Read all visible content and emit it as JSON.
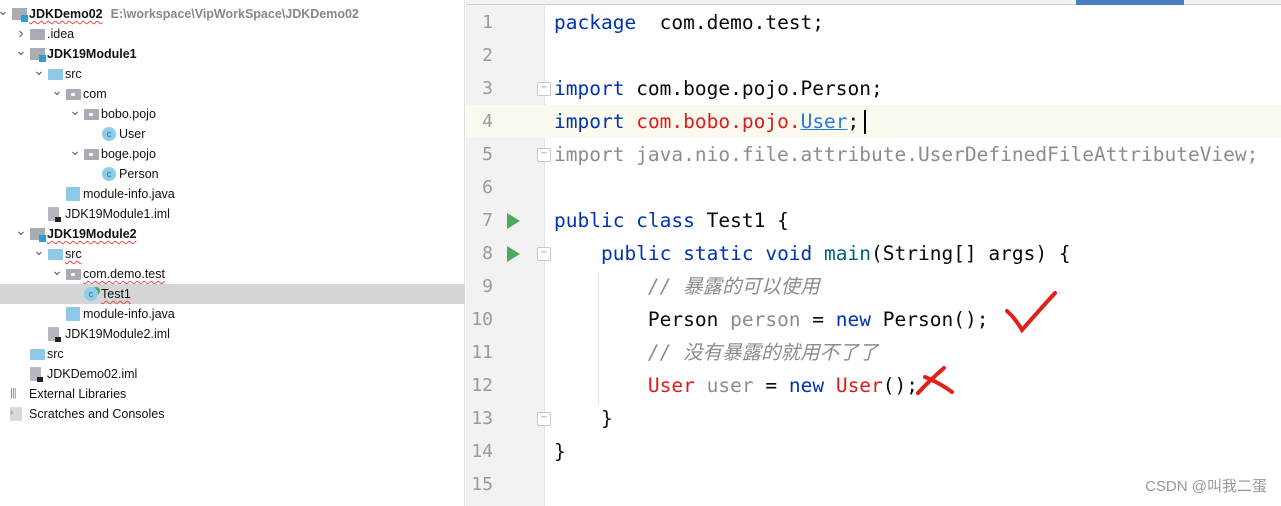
{
  "project_tree": {
    "items": [
      {
        "label": "JDKDemo02",
        "path": "E:\\workspace\\VipWorkSpace\\JDKDemo02",
        "level": 0,
        "icon": "module-icon",
        "expanded": true,
        "bold": true,
        "error": true
      },
      {
        "label": ".idea",
        "level": 1,
        "icon": "folder-icon",
        "expanded": false
      },
      {
        "label": "JDK19Module1",
        "level": 1,
        "icon": "module-icon",
        "expanded": true,
        "bold": true
      },
      {
        "label": "src",
        "level": 2,
        "icon": "source-folder-icon",
        "expanded": true
      },
      {
        "label": "com",
        "level": 3,
        "icon": "package-icon",
        "expanded": true
      },
      {
        "label": "bobo.pojo",
        "level": 4,
        "icon": "package-icon",
        "expanded": true
      },
      {
        "label": "User",
        "level": 5,
        "icon": "class-icon"
      },
      {
        "label": "boge.pojo",
        "level": 4,
        "icon": "package-icon",
        "expanded": true
      },
      {
        "label": "Person",
        "level": 5,
        "icon": "class-icon"
      },
      {
        "label": "module-info.java",
        "level": 3,
        "icon": "java-file-icon"
      },
      {
        "label": "JDK19Module1.iml",
        "level": 2,
        "icon": "iml-file-icon"
      },
      {
        "label": "JDK19Module2",
        "level": 1,
        "icon": "module-icon",
        "expanded": true,
        "bold": true,
        "error": true
      },
      {
        "label": "src",
        "level": 2,
        "icon": "source-folder-icon",
        "expanded": true,
        "error": true
      },
      {
        "label": "com.demo.test",
        "level": 3,
        "icon": "package-icon",
        "expanded": true,
        "error": true
      },
      {
        "label": "Test1",
        "level": 4,
        "icon": "runnable-class-icon",
        "selected": true,
        "error": true
      },
      {
        "label": "module-info.java",
        "level": 3,
        "icon": "java-file-icon"
      },
      {
        "label": "JDK19Module2.iml",
        "level": 2,
        "icon": "iml-file-icon"
      },
      {
        "label": "src",
        "level": 1,
        "icon": "source-folder-icon"
      },
      {
        "label": "JDKDemo02.iml",
        "level": 1,
        "icon": "iml-file-icon"
      },
      {
        "label": "External Libraries",
        "level": 0,
        "icon": "libraries-icon"
      },
      {
        "label": "Scratches and Consoles",
        "level": 0,
        "icon": "scratches-icon"
      }
    ]
  },
  "editor": {
    "current_line": 4,
    "lines": [
      {
        "n": "1",
        "tokens": [
          [
            "kw",
            "package"
          ],
          [
            "",
            "  com.demo.test;"
          ]
        ]
      },
      {
        "n": "2",
        "tokens": []
      },
      {
        "n": "3",
        "fold": true,
        "tokens": [
          [
            "kw",
            "import"
          ],
          [
            "",
            " com.boge.pojo.Person;"
          ]
        ]
      },
      {
        "n": "4",
        "tokens": [
          [
            "kw",
            "import"
          ],
          [
            "",
            " "
          ],
          [
            "red",
            "com.bobo.pojo."
          ],
          [
            "link",
            "User"
          ],
          [
            "",
            ";"
          ]
        ]
      },
      {
        "n": "5",
        "fold": true,
        "tokens": [
          [
            "gray",
            "import java.nio.file.attribute.UserDefinedFileAttributeView;"
          ]
        ]
      },
      {
        "n": "6",
        "tokens": []
      },
      {
        "n": "7",
        "run": true,
        "tokens": [
          [
            "kw",
            "public class"
          ],
          [
            "",
            " Test1 {"
          ]
        ]
      },
      {
        "n": "8",
        "run": true,
        "fold": true,
        "tokens": [
          [
            "",
            "    "
          ],
          [
            "kw",
            "public static void"
          ],
          [
            "",
            " "
          ],
          [
            "fn",
            "main"
          ],
          [
            "",
            "(String[] args) {"
          ]
        ]
      },
      {
        "n": "9",
        "tokens": [
          [
            "",
            "        "
          ],
          [
            "cm",
            "// 暴露的可以使用"
          ]
        ]
      },
      {
        "n": "10",
        "tokens": [
          [
            "",
            "        Person "
          ],
          [
            "gray",
            "person"
          ],
          [
            "",
            " = "
          ],
          [
            "kw",
            "new"
          ],
          [
            "",
            " Person();"
          ]
        ]
      },
      {
        "n": "11",
        "tokens": [
          [
            "",
            "        "
          ],
          [
            "cm",
            "// 没有暴露的就用不了了"
          ]
        ]
      },
      {
        "n": "12",
        "tokens": [
          [
            "",
            "        "
          ],
          [
            "red",
            "User"
          ],
          [
            "",
            " "
          ],
          [
            "gray",
            "user"
          ],
          [
            "",
            " = "
          ],
          [
            "kw",
            "new"
          ],
          [
            "",
            " "
          ],
          [
            "red",
            "User"
          ],
          [
            "",
            "();"
          ]
        ]
      },
      {
        "n": "13",
        "fold": true,
        "tokens": [
          [
            "",
            "    }"
          ]
        ]
      },
      {
        "n": "14",
        "tokens": [
          [
            "",
            "}"
          ]
        ]
      },
      {
        "n": "15",
        "tokens": []
      }
    ]
  },
  "annotations": {
    "check_color": "#e0201a",
    "cross_color": "#e0201a"
  },
  "watermark": "CSDN @叫我二蛋"
}
